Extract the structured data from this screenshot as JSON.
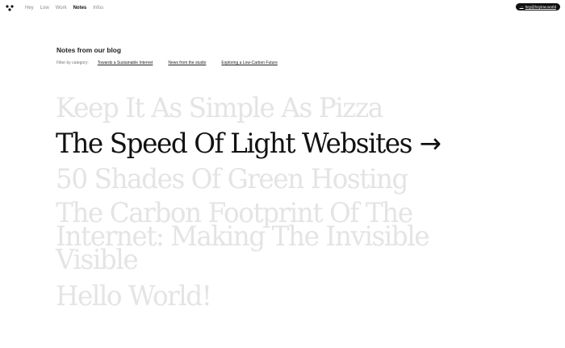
{
  "nav": {
    "items": [
      {
        "label": "Hey",
        "active": false
      },
      {
        "label": "Low",
        "active": false
      },
      {
        "label": "Work",
        "active": false
      },
      {
        "label": "Notes",
        "active": true
      },
      {
        "label": "Infos",
        "active": false
      }
    ]
  },
  "contact": {
    "arrow": "→",
    "email": "hey@heylow.world"
  },
  "blog": {
    "title": "Notes from our blog",
    "filter_label": "Filter by category:",
    "categories": [
      "Towards a Sustainable Internet",
      "News from the studio",
      "Exploring a Low-Carbon Future"
    ]
  },
  "posts": [
    {
      "title": "Keep It As Simple As Pizza",
      "active": false
    },
    {
      "title": "The Speed Of Light Websites",
      "active": true,
      "arrow": "→"
    },
    {
      "title": "50 Shades Of Green Hosting",
      "active": false
    },
    {
      "title": "The Carbon Footprint Of The Internet: Making The Invisible Visible",
      "active": false
    },
    {
      "title": "Hello World!",
      "active": false
    }
  ],
  "colors": {
    "text": "#111111",
    "muted": "#8a8a8a",
    "inactive_post": "#e4e4e4",
    "background": "#ffffff"
  }
}
